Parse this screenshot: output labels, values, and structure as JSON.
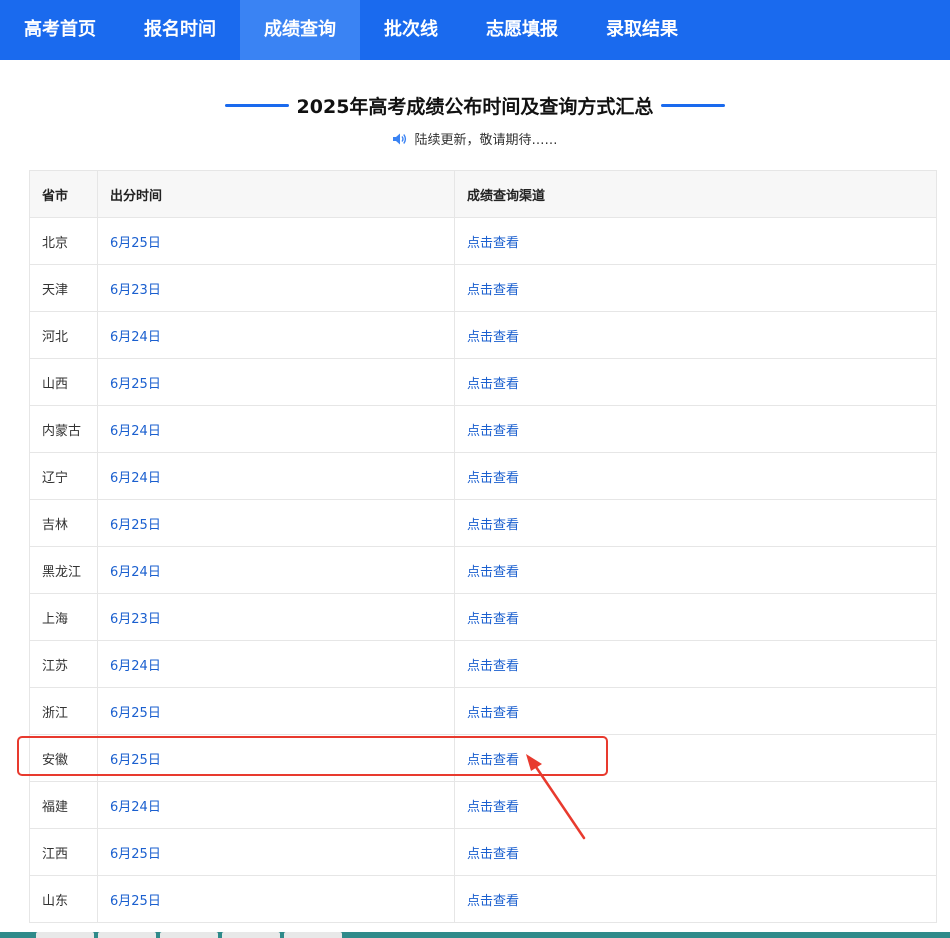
{
  "nav": {
    "items": [
      {
        "label": "高考首页"
      },
      {
        "label": "报名时间"
      },
      {
        "label": "成绩查询",
        "active": true
      },
      {
        "label": "批次线"
      },
      {
        "label": "志愿填报"
      },
      {
        "label": "录取结果"
      }
    ]
  },
  "header": {
    "title": "2025年高考成绩公布时间及查询方式汇总",
    "subtitle": "陆续更新，敬请期待……"
  },
  "table": {
    "columns": [
      "省市",
      "出分时间",
      "成绩查询渠道"
    ],
    "rows": [
      {
        "province": "北京",
        "time": "6月25日",
        "link": "点击查看"
      },
      {
        "province": "天津",
        "time": "6月23日",
        "link": "点击查看"
      },
      {
        "province": "河北",
        "time": "6月24日",
        "link": "点击查看"
      },
      {
        "province": "山西",
        "time": "6月25日",
        "link": "点击查看"
      },
      {
        "province": "内蒙古",
        "time": "6月24日",
        "link": "点击查看"
      },
      {
        "province": "辽宁",
        "time": "6月24日",
        "link": "点击查看"
      },
      {
        "province": "吉林",
        "time": "6月25日",
        "link": "点击查看"
      },
      {
        "province": "黑龙江",
        "time": "6月24日",
        "link": "点击查看"
      },
      {
        "province": "上海",
        "time": "6月23日",
        "link": "点击查看"
      },
      {
        "province": "江苏",
        "time": "6月24日",
        "link": "点击查看"
      },
      {
        "province": "浙江",
        "time": "6月25日",
        "link": "点击查看"
      },
      {
        "province": "安徽",
        "time": "6月25日",
        "link": "点击查看"
      },
      {
        "province": "福建",
        "time": "6月24日",
        "link": "点击查看"
      },
      {
        "province": "江西",
        "time": "6月25日",
        "link": "点击查看"
      },
      {
        "province": "山东",
        "time": "6月25日",
        "link": "点击查看"
      }
    ]
  },
  "colors": {
    "nav_bg": "#1a6aee",
    "nav_active": "#3a83f3",
    "link": "#1a5fcf",
    "highlight": "#e83a2e"
  },
  "icons": {
    "subtitle_icon": "speaker-icon"
  }
}
